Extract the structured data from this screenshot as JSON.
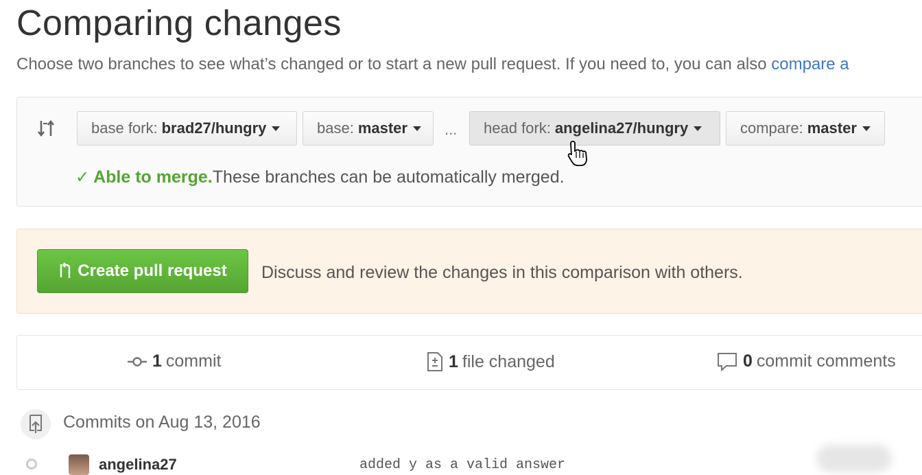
{
  "header": {
    "title": "Comparing changes",
    "subtitle": "Choose two branches to see what’s changed or to start a new pull request. If you need to, you can also ",
    "subtitle_link": "compare a"
  },
  "range": {
    "base_fork_label": "base fork:",
    "base_fork_value": "brad27/hungry",
    "base_label": "base:",
    "base_value": "master",
    "separator": "...",
    "head_fork_label": "head fork:",
    "head_fork_value": "angelina27/hungry",
    "compare_label": "compare:",
    "compare_value": "master"
  },
  "merge": {
    "check": "✓",
    "status": "Able to merge.",
    "message": " These branches can be automatically merged."
  },
  "pull_request": {
    "button_label": "Create pull request",
    "description": "Discuss and review the changes in this comparison with others."
  },
  "stats": {
    "commits_count": "1",
    "commits_label": "commit",
    "files_count": "1",
    "files_label": "file changed",
    "comments_count": "0",
    "comments_label": "commit comments"
  },
  "commits": {
    "heading": "Commits on Aug 13, 2016",
    "items": [
      {
        "author": "angelina27",
        "message": "added y as a valid answer"
      }
    ]
  },
  "colors": {
    "green": "#55a532",
    "link": "#4078c0",
    "pr_box_bg": "#fdf3e7"
  }
}
